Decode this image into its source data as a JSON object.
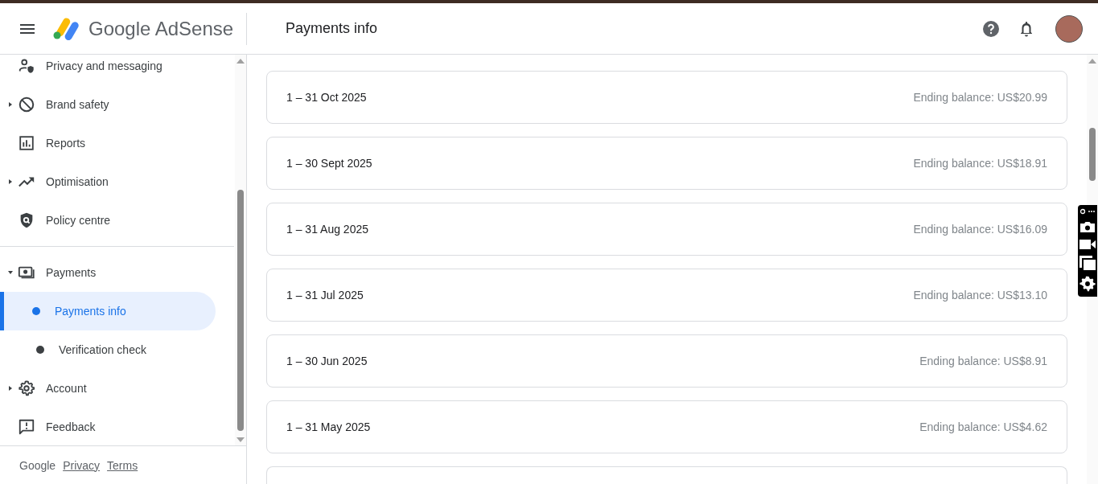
{
  "header": {
    "product": "Google AdSense",
    "page_title": "Payments info"
  },
  "sidebar": {
    "sections": [
      [
        {
          "label": "Privacy and messaging"
        },
        {
          "label": "Brand safety",
          "expanded": false
        },
        {
          "label": "Reports"
        },
        {
          "label": "Optimisation",
          "expanded": false
        },
        {
          "label": "Policy centre"
        }
      ],
      [
        {
          "label": "Payments",
          "expanded": true,
          "children": [
            {
              "label": "Payments info",
              "selected": true
            },
            {
              "label": "Verification check",
              "selected": false
            }
          ]
        },
        {
          "label": "Account",
          "expanded": false
        },
        {
          "label": "Feedback"
        }
      ]
    ],
    "footer": {
      "brand": "Google",
      "links": [
        "Privacy",
        "Terms"
      ]
    }
  },
  "statements": [
    {
      "period": "1 – 31 Oct 2025",
      "balance": "Ending balance: US$20.99"
    },
    {
      "period": "1 – 30 Sept 2025",
      "balance": "Ending balance: US$18.91"
    },
    {
      "period": "1 – 31 Aug 2025",
      "balance": "Ending balance: US$16.09"
    },
    {
      "period": "1 – 31 Jul 2025",
      "balance": "Ending balance: US$13.10"
    },
    {
      "period": "1 – 30 Jun 2025",
      "balance": "Ending balance: US$8.91"
    },
    {
      "period": "1 – 31 May 2025",
      "balance": "Ending balance: US$4.62"
    }
  ]
}
